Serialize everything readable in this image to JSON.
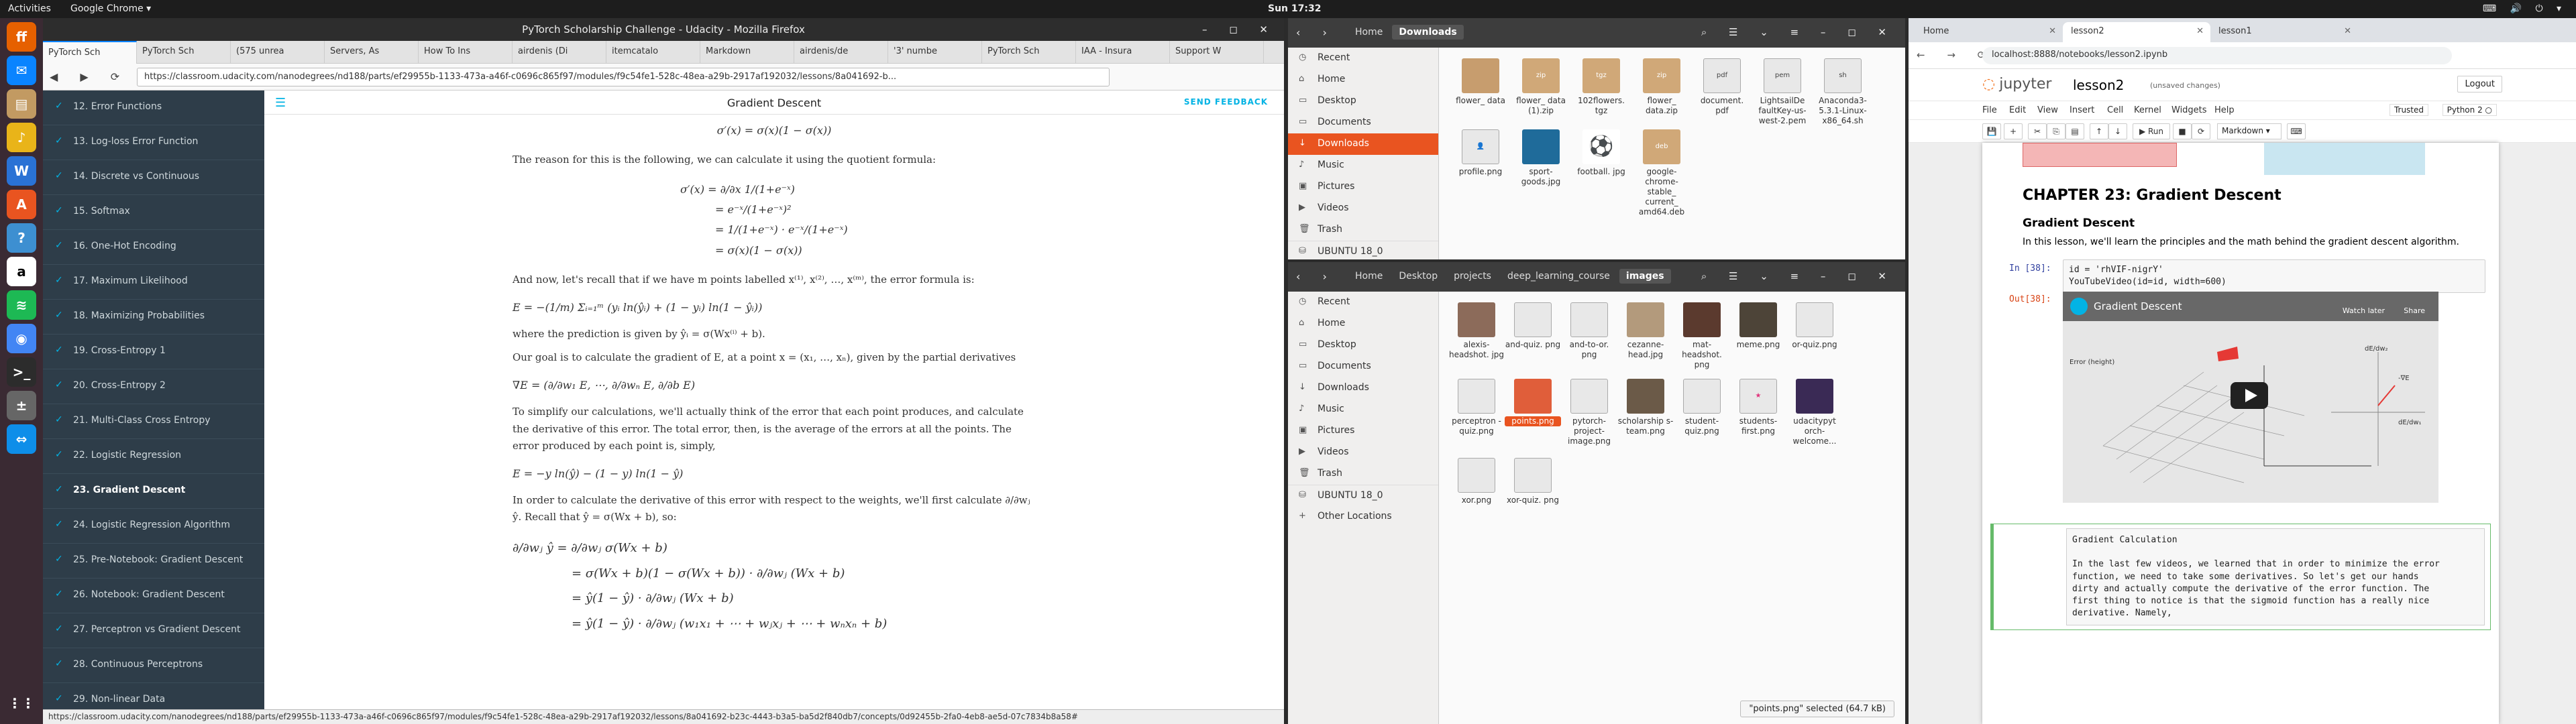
{
  "topbar": {
    "activities": "Activities",
    "app_menu": "Google Chrome ▾",
    "clock": "Sun 17:32",
    "tray": "⌨ 🔊 ⏻ ▾"
  },
  "dock": {
    "icons": [
      "firefox-icon",
      "thunderbird-icon",
      "files-icon",
      "rhythmbox-icon",
      "libreoffice-writer-icon",
      "ubuntu-software-icon",
      "help-icon",
      "amazon-icon",
      "spotify-icon",
      "chrome-icon",
      "terminal-icon",
      "calculator-icon",
      "teamviewer-icon",
      "show-apps-icon"
    ]
  },
  "firefox": {
    "window_title": "PyTorch Scholarship Challenge - Udacity - Mozilla Firefox",
    "tabs": [
      "PyTorch Sch",
      "PyTorch Sch",
      "(575 unrea",
      "Servers, As",
      "How To Ins",
      "airdenis (Di",
      "itemcatalo",
      "Markdown",
      "airdenis/de",
      "'3' numbe",
      "PyTorch Sch",
      "IAA - Insura",
      "Support W"
    ],
    "url": "https://classroom.udacity.com/nanodegrees/nd188/parts/ef29955b-1133-473a-a46f-c0696c865f97/modules/f9c54fe1-528c-48ea-a29b-2917af192032/lessons/8a041692-b...",
    "status_url": "https://classroom.udacity.com/nanodegrees/nd188/parts/ef29955b-1133-473a-a46f-c0696c865f97/modules/f9c54fe1-528c-48ea-a29b-2917af192032/lessons/8a041692-b23c-4443-b3a5-ba5d2f840db7/concepts/0d92455b-2fa0-4eb8-ae5d-07c7834b8a58#",
    "sidebar": [
      {
        "label": "12. Error Functions",
        "active": false
      },
      {
        "label": "13. Log-loss Error Function",
        "active": false
      },
      {
        "label": "14. Discrete vs Continuous",
        "active": false
      },
      {
        "label": "15. Softmax",
        "active": false
      },
      {
        "label": "16. One-Hot Encoding",
        "active": false
      },
      {
        "label": "17. Maximum Likelihood",
        "active": false
      },
      {
        "label": "18. Maximizing Probabilities",
        "active": false
      },
      {
        "label": "19. Cross-Entropy 1",
        "active": false
      },
      {
        "label": "20. Cross-Entropy 2",
        "active": false
      },
      {
        "label": "21. Multi-Class Cross Entropy",
        "active": false
      },
      {
        "label": "22. Logistic Regression",
        "active": false
      },
      {
        "label": "23. Gradient Descent",
        "active": true
      },
      {
        "label": "24. Logistic Regression Algorithm",
        "active": false
      },
      {
        "label": "25. Pre-Notebook: Gradient Descent",
        "active": false
      },
      {
        "label": "26. Notebook: Gradient Descent",
        "active": false
      },
      {
        "label": "27. Perceptron vs Gradient Descent",
        "active": false
      },
      {
        "label": "28. Continuous Perceptrons",
        "active": false
      },
      {
        "label": "29. Non-linear Data",
        "active": false
      }
    ],
    "page_title": "Gradient Descent",
    "send_feedback": "SEND FEEDBACK",
    "body": {
      "eq_top": "σ′(x) = σ(x)(1 − σ(x))",
      "p1": "The reason for this is the following, we can calculate it using the quotient formula:",
      "eq_quot_1": "σ′(x) = ∂/∂x 1/(1+e⁻ˣ)",
      "eq_quot_2": "= e⁻ˣ/(1+e⁻ˣ)²",
      "eq_quot_3": "= 1/(1+e⁻ˣ) · e⁻ˣ/(1+e⁻ˣ)",
      "eq_quot_4": "= σ(x)(1 − σ(x))",
      "p2": "And now, let's recall that if we have m points labelled x⁽¹⁾, x⁽²⁾, …, x⁽ᵐ⁾, the error formula is:",
      "eq_error": "E = −(1/m) Σᵢ₌₁ᵐ (yᵢ ln(ŷᵢ) + (1 − yᵢ) ln(1 − ŷᵢ))",
      "p3": "where the prediction is given by ŷᵢ = σ(Wx⁽ⁱ⁾ + b).",
      "p4": "Our goal is to calculate the gradient of E, at a point x = (x₁, …, xₙ), given by the partial derivatives",
      "eq_grad": "∇E = (∂/∂w₁ E, ⋯, ∂/∂wₙ E, ∂/∂b E)",
      "p5": "To simplify our calculations, we'll actually think of the error that each point produces, and calculate the derivative of this error. The total error, then, is the average of the errors at all the points. The error produced by each point is, simply,",
      "eq_point": "E = −y ln(ŷ) − (1 − y) ln(1 − ŷ)",
      "p6": "In order to calculate the derivative of this error with respect to the weights, we'll first calculate ∂/∂wⱼ ŷ. Recall that ŷ = σ(Wx + b), so:",
      "eq_d1": "∂/∂wⱼ ŷ = ∂/∂wⱼ σ(Wx + b)",
      "eq_d2": "= σ(Wx + b)(1 − σ(Wx + b)) · ∂/∂wⱼ (Wx + b)",
      "eq_d3": "= ŷ(1 − ŷ) · ∂/∂wⱼ (Wx + b)",
      "eq_d4": "= ŷ(1 − ŷ) · ∂/∂wⱼ (w₁x₁ + ⋯ + wⱼxⱼ + ⋯ + wₙxₙ + b)"
    }
  },
  "nautilus_downloads": {
    "crumbs": [
      "Home",
      "Downloads"
    ],
    "sidebar": [
      "Recent",
      "Home",
      "Desktop",
      "Documents",
      "Downloads",
      "Music",
      "Pictures",
      "Videos",
      "Trash",
      "UBUNTU 18_0"
    ],
    "selected": "Downloads",
    "files": [
      {
        "name": "flower_ data",
        "type": "folder"
      },
      {
        "name": "flower_ data (1).zip",
        "type": "archive"
      },
      {
        "name": "102flowers. tgz",
        "type": "archive"
      },
      {
        "name": "flower_ data.zip",
        "type": "archive"
      },
      {
        "name": "document. pdf",
        "type": "doc"
      },
      {
        "name": "LightsailDe faultKey-us- west-2.pem",
        "type": "doc"
      },
      {
        "name": "Anaconda3- 5.3.1-Linux- x86_64.sh",
        "type": "doc"
      },
      {
        "name": "profile.png",
        "type": "img"
      },
      {
        "name": "sport- goods.jpg",
        "type": "img"
      },
      {
        "name": "football. jpg",
        "type": "img"
      },
      {
        "name": "google- chrome- stable_ current_ amd64.deb",
        "type": "archive"
      }
    ]
  },
  "nautilus_images": {
    "crumbs": [
      "Home",
      "Desktop",
      "projects",
      "deep_learning_course",
      "images"
    ],
    "sidebar": [
      "Recent",
      "Home",
      "Desktop",
      "Documents",
      "Downloads",
      "Music",
      "Pictures",
      "Videos",
      "Trash",
      "UBUNTU 18_0",
      "Other Locations"
    ],
    "files": [
      {
        "name": "alexis- headshot. jpg",
        "type": "img"
      },
      {
        "name": "and-quiz. png",
        "type": "doc"
      },
      {
        "name": "and-to-or. png",
        "type": "doc"
      },
      {
        "name": "cezanne- head.jpg",
        "type": "img"
      },
      {
        "name": "mat- headshot. png",
        "type": "img"
      },
      {
        "name": "meme.png",
        "type": "img"
      },
      {
        "name": "or-quiz.png",
        "type": "doc"
      },
      {
        "name": "perceptron -quiz.png",
        "type": "doc"
      },
      {
        "name": "points.png",
        "type": "img",
        "selected": true
      },
      {
        "name": "pytorch- project- image.png",
        "type": "doc"
      },
      {
        "name": "scholarship s-team.png",
        "type": "img"
      },
      {
        "name": "student- quiz.png",
        "type": "doc"
      },
      {
        "name": "students- first.png",
        "type": "doc"
      },
      {
        "name": "udacitypyt orch- welcome...",
        "type": "img"
      },
      {
        "name": "xor.png",
        "type": "doc"
      },
      {
        "name": "xor-quiz. png",
        "type": "doc"
      }
    ],
    "status": "\"points.png\" selected  (64.7 kB)"
  },
  "chrome": {
    "tabs": [
      "Home",
      "lesson2",
      "lesson1"
    ],
    "url": "localhost:8888/notebooks/lesson2.ipynb",
    "jupyter": {
      "logo_text": "jupyter",
      "notebook_name": "lesson2",
      "saved_status": "(unsaved changes)",
      "logout": "Logout",
      "menus": [
        "File",
        "Edit",
        "View",
        "Insert",
        "Cell",
        "Kernel",
        "Widgets",
        "Help"
      ],
      "trusted": "Trusted",
      "kernel": "Python 2 ○",
      "run_label": "▶ Run",
      "cell_type": "Markdown",
      "h1": "CHAPTER 23: Gradient Descent",
      "h2": "Gradient Descent",
      "intro": "In this lesson, we'll learn the principles and the math behind the gradient descent algorithm.",
      "in_prompt": "In [38]:",
      "code_line1": "id = 'rhVIF-nigrY'",
      "code_line2": "YouTubeVideo(id=id, width=600)",
      "out_prompt": "Out[38]:",
      "video_title": "Gradient Descent",
      "video_watch_later": "Watch later",
      "video_share": "Share",
      "video_error_label": "Error (height)",
      "video_dwdr": "dE/dw₂",
      "video_dw1": "dE/dw₁",
      "video_grad": "-∇E",
      "edit_cell_text": "Gradient Calculation\n\nIn the last few videos, we learned that in order to minimize the error\nfunction, we need to take some derivatives. So let's get our hands\ndirty and actually compute the derivative of the error function. The\nfirst thing to notice is that the sigmoid function has a really nice\nderivative. Namely,\n"
    }
  }
}
